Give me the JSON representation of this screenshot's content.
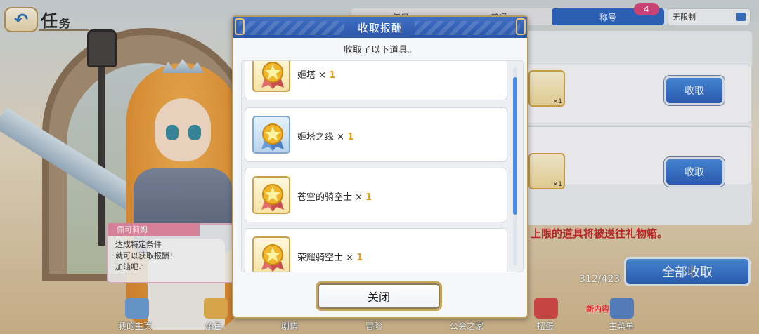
{
  "header": {
    "title_main": "任",
    "title_small": "务",
    "back_icon": "back-arrow-icon"
  },
  "tabs": [
    {
      "label": "每日"
    },
    {
      "label": "普通"
    },
    {
      "label": "称号",
      "active": true,
      "badge": "4"
    }
  ],
  "filter": {
    "value": "无限制",
    "icon": "filter-icon"
  },
  "missions": [
    {
      "reward_count": "×1",
      "claim_label": "收取"
    },
    {
      "reward_count": "×1",
      "claim_label": "收取"
    }
  ],
  "overflow_note": "上限的道具将被送往礼物箱。",
  "claim_all_label": "全部收取",
  "page_counter": "312/423",
  "dialog": {
    "name": "佩可莉姆",
    "lines": [
      "达成特定条件",
      "就可以获取报酬！",
      "加油吧♪"
    ]
  },
  "bottom_nav": [
    {
      "label": "我的主页"
    },
    {
      "label": "角色"
    },
    {
      "label": "剧情"
    },
    {
      "label": "冒险"
    },
    {
      "label": "公会之家"
    },
    {
      "label": "扭蛋"
    },
    {
      "label": "主菜单"
    }
  ],
  "new_badge": "新内容",
  "modal": {
    "title": "收取报酬",
    "subtitle": "收取了以下道具。",
    "items": [
      {
        "name": "姬塔",
        "qty": "1",
        "icon_style": "gold",
        "icon": "medal-icon"
      },
      {
        "name": "姬塔之缘",
        "qty": "1",
        "icon_style": "blue",
        "icon": "medal-icon"
      },
      {
        "name": "苍空的骑空士",
        "qty": "1",
        "icon_style": "gold",
        "icon": "medal-icon"
      },
      {
        "name": "荣耀骑空士",
        "qty": "1",
        "icon_style": "gold",
        "icon": "medal-icon"
      }
    ],
    "close_label": "关闭"
  },
  "colors": {
    "accent_blue": "#2f68c4",
    "qty_orange": "#e89b1d",
    "frame_gold": "#b79a5d",
    "note_red": "#c62b2b"
  }
}
